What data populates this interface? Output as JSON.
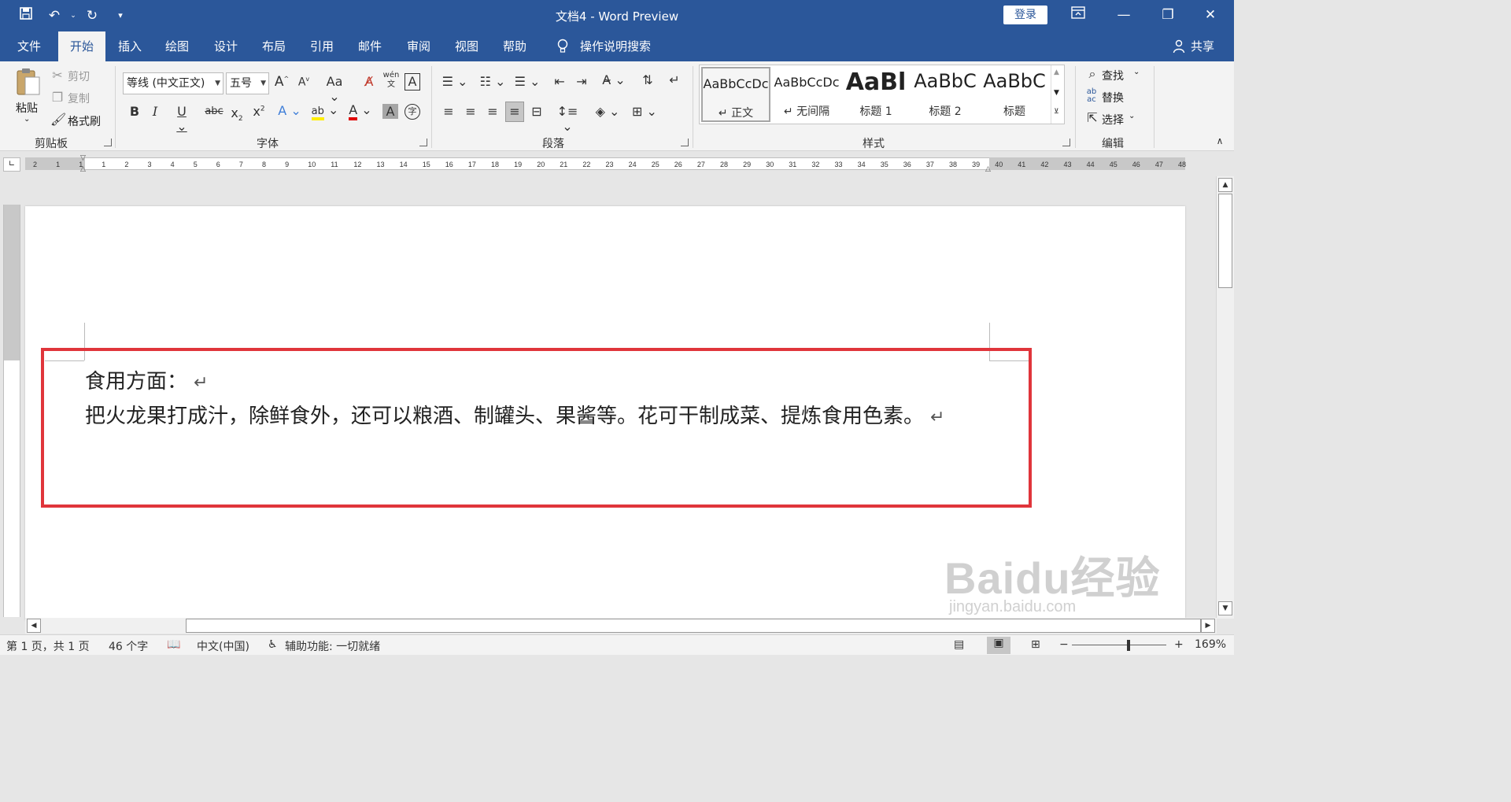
{
  "titlebar": {
    "title": "文档4  -  Word Preview",
    "login_label": "登录"
  },
  "tabs": [
    {
      "label": "文件"
    },
    {
      "label": "开始"
    },
    {
      "label": "插入"
    },
    {
      "label": "绘图"
    },
    {
      "label": "设计"
    },
    {
      "label": "布局"
    },
    {
      "label": "引用"
    },
    {
      "label": "邮件"
    },
    {
      "label": "审阅"
    },
    {
      "label": "视图"
    },
    {
      "label": "帮助"
    }
  ],
  "tell_me": "操作说明搜索",
  "share": "共享",
  "clipboard": {
    "paste": "粘贴",
    "cut": "剪切",
    "copy": "复制",
    "format_painter": "格式刷",
    "label": "剪贴板"
  },
  "font": {
    "font_name": "等线 (中文正文)",
    "font_size": "五号",
    "label": "字体",
    "phonetic": "wén"
  },
  "paragraph": {
    "label": "段落"
  },
  "styles": {
    "label": "样式",
    "items": [
      {
        "sample": "AaBbCcDc",
        "name": "↵ 正文"
      },
      {
        "sample": "AaBbCcDc",
        "name": "↵ 无间隔"
      },
      {
        "sample": "AaBl",
        "name": "标题 1"
      },
      {
        "sample": "AaBbC",
        "name": "标题 2"
      },
      {
        "sample": "AaBbC",
        "name": "标题"
      }
    ]
  },
  "editing": {
    "find": "查找",
    "replace": "替换",
    "select": "选择",
    "label": "编辑"
  },
  "ruler": {
    "ticks": [
      "2",
      "1",
      "1",
      "1",
      "2",
      "3",
      "4",
      "5",
      "6",
      "7",
      "8",
      "9",
      "10",
      "11",
      "12",
      "13",
      "14",
      "15",
      "16",
      "17",
      "18",
      "19",
      "20",
      "21",
      "22",
      "23",
      "24",
      "25",
      "26",
      "27",
      "28",
      "29",
      "30",
      "31",
      "32",
      "33",
      "34",
      "35",
      "36",
      "37",
      "38",
      "39",
      "40",
      "41",
      "42",
      "43",
      "44",
      "45",
      "46",
      "47",
      "48"
    ]
  },
  "document": {
    "line1": "食用方面：",
    "line2": "把火龙果打成汁，除鲜食外，还可以粮酒、制罐头、果酱等。花可干制成菜、提炼食用色素。"
  },
  "status": {
    "page": "第 1 页，共 1 页",
    "words": "46 个字",
    "language": "中文(中国)",
    "accessibility": "辅助功能: 一切就绪",
    "zoom": "169%"
  },
  "watermark": {
    "big": "Baidu经验",
    "small": "jingyan.baidu.com"
  },
  "colors": {
    "accent": "#2b579a",
    "highlight_box": "#e0353b"
  }
}
